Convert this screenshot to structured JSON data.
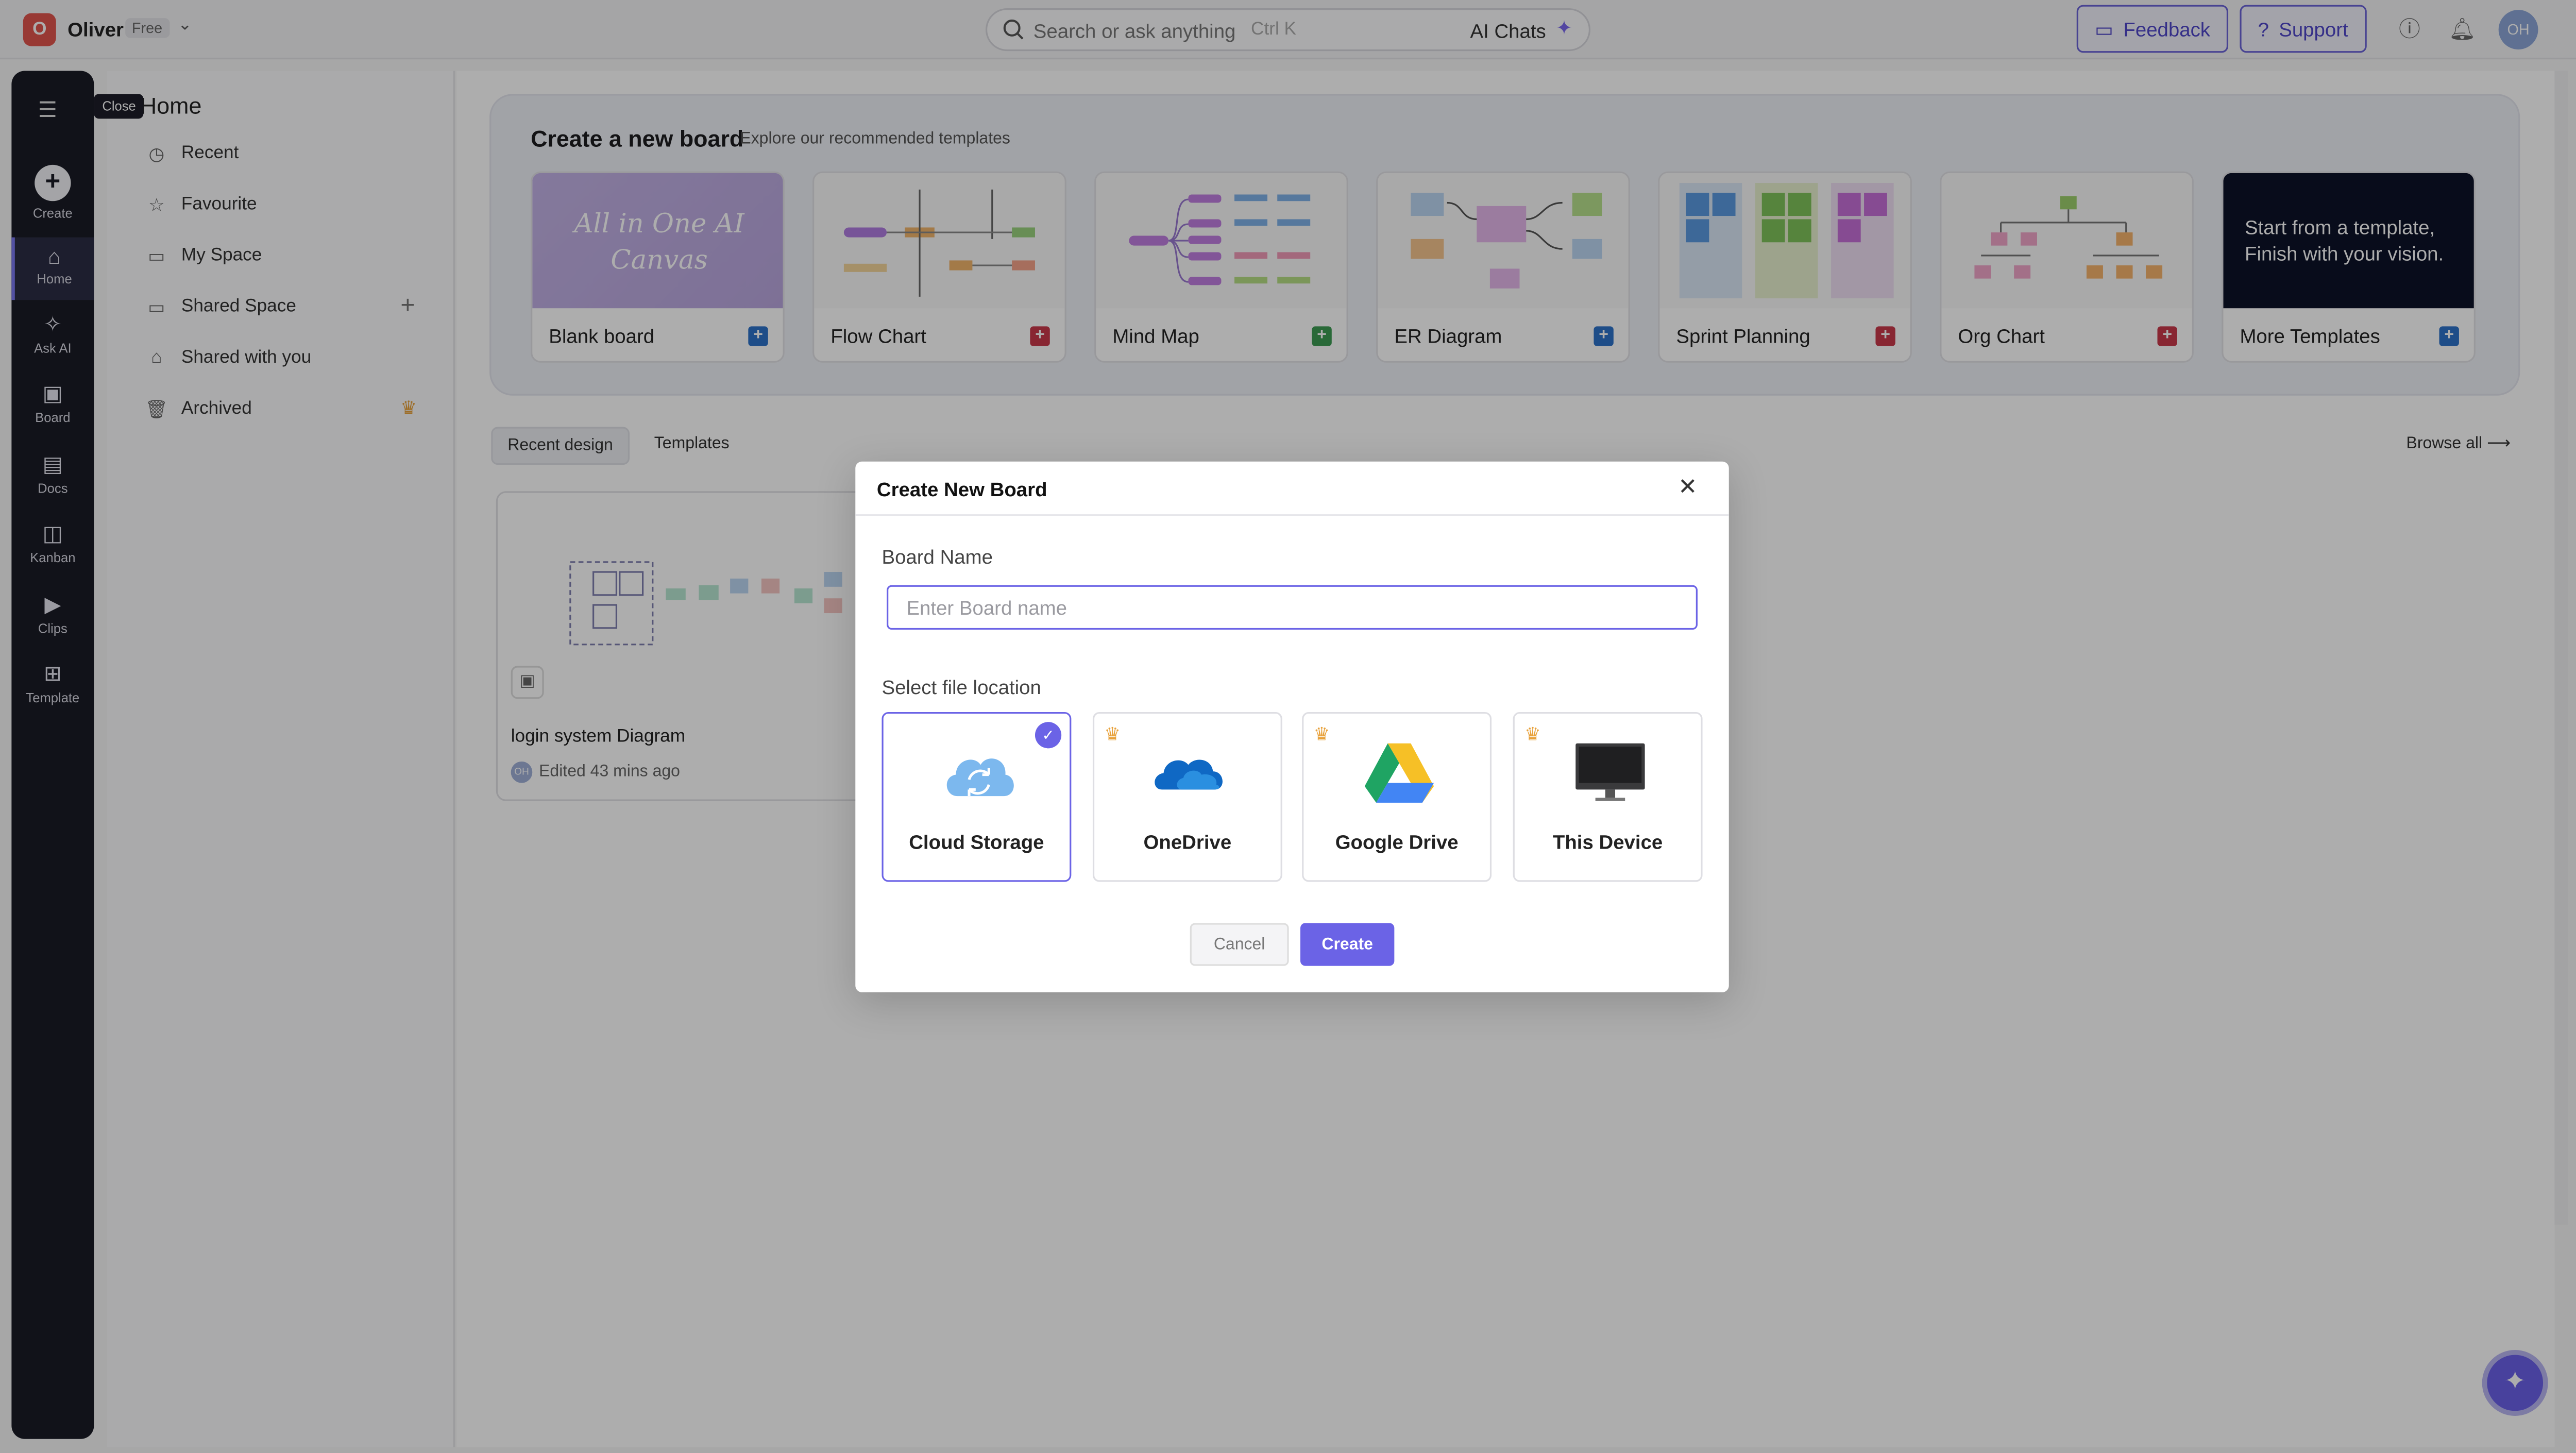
{
  "workspace": {
    "initial": "O",
    "name": "Oliver",
    "plan": "Free"
  },
  "search": {
    "placeholder": "Search or ask anything",
    "shortcut": "Ctrl K",
    "ai_label": "AI Chats"
  },
  "topbar": {
    "feedback": "Feedback",
    "support": "Support",
    "user_initials": "OH"
  },
  "rail": {
    "tooltip": "Close",
    "items": [
      {
        "label": "Create",
        "icon": "plus-icon"
      },
      {
        "label": "Home",
        "icon": "home-icon"
      },
      {
        "label": "Ask AI",
        "icon": "sparkle-icon"
      },
      {
        "label": "Board",
        "icon": "board-icon"
      },
      {
        "label": "Docs",
        "icon": "docs-icon"
      },
      {
        "label": "Kanban",
        "icon": "kanban-icon"
      },
      {
        "label": "Clips",
        "icon": "clips-icon"
      },
      {
        "label": "Template",
        "icon": "template-icon"
      }
    ]
  },
  "sidebar": {
    "title": "Home",
    "items": [
      {
        "label": "Recent",
        "icon": "clock-icon"
      },
      {
        "label": "Favourite",
        "icon": "star-icon"
      },
      {
        "label": "My Space",
        "icon": "folder-icon"
      },
      {
        "label": "Shared Space",
        "icon": "shared-folder-icon"
      },
      {
        "label": "Shared with you",
        "icon": "shared-icon"
      },
      {
        "label": "Archived",
        "icon": "trash-icon"
      }
    ]
  },
  "banner": {
    "title": "Create a new board",
    "subtitle": "Explore our recommended templates",
    "templates": [
      {
        "label": "Blank board",
        "color": "#2d72c9",
        "thumb_text": "All in One AI Canvas"
      },
      {
        "label": "Flow Chart",
        "color": "#c9384a"
      },
      {
        "label": "Mind Map",
        "color": "#3d9b53"
      },
      {
        "label": "ER Diagram",
        "color": "#2d72c9"
      },
      {
        "label": "Sprint Planning",
        "color": "#c9384a"
      },
      {
        "label": "Org Chart",
        "color": "#c9384a"
      },
      {
        "label": "More Templates",
        "color": "#2d72c9",
        "thumb_text": "Start from a template, Finish with your vision."
      }
    ]
  },
  "recent": {
    "tabs": [
      "Recent design",
      "Templates"
    ],
    "browse_all": "Browse all",
    "designs": [
      {
        "title": "login system Diagram",
        "edited": "Edited 43 mins ago",
        "owner_initials": "OH"
      }
    ]
  },
  "modal": {
    "title": "Create New Board",
    "board_name_label": "Board Name",
    "board_name_placeholder": "Enter Board name",
    "board_name_value": "",
    "location_label": "Select file location",
    "locations": [
      {
        "label": "Cloud Storage",
        "selected": true,
        "premium": false
      },
      {
        "label": "OneDrive",
        "selected": false,
        "premium": true
      },
      {
        "label": "Google Drive",
        "selected": false,
        "premium": true
      },
      {
        "label": "This Device",
        "selected": false,
        "premium": true
      }
    ],
    "cancel": "Cancel",
    "create": "Create"
  },
  "colors": {
    "accent": "#6b63e6",
    "rail": "#1a1b26",
    "premium": "#e8a13a"
  }
}
